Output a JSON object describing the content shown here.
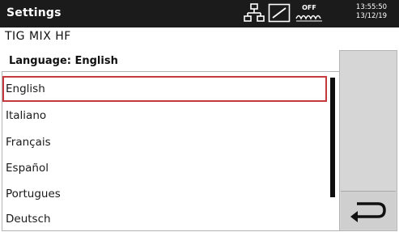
{
  "header": {
    "title": "Settings",
    "icons": [
      "network-icon",
      "slope-icon",
      "wave-off-icon"
    ],
    "wave_icon_label": "OFF",
    "time": "13:55:50",
    "date": "13/12/19"
  },
  "process": {
    "label": "TIG MIX HF"
  },
  "language_panel": {
    "header": "Language: English",
    "items": [
      {
        "label": "English",
        "selected": true
      },
      {
        "label": "Italiano",
        "selected": false
      },
      {
        "label": "Français",
        "selected": false
      },
      {
        "label": "Español",
        "selected": false
      },
      {
        "label": "Portugues",
        "selected": false
      },
      {
        "label": "Deutsch",
        "selected": false
      }
    ]
  },
  "side_panel": {
    "back_icon": "return-arrow-icon"
  },
  "colors": {
    "header_bg": "#1b1b1b",
    "selection_border": "#c5383c",
    "panel_bg": "#d6d6d6",
    "scroll_thumb": "#0e0e0e"
  }
}
